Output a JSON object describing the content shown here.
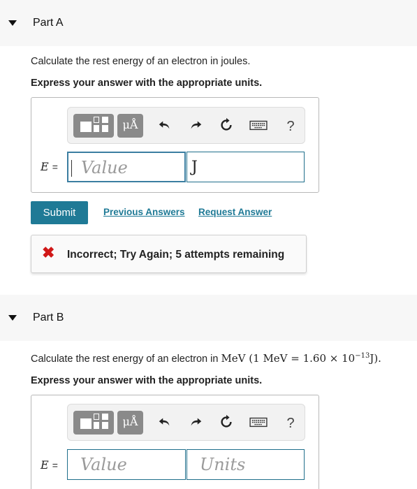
{
  "part_a": {
    "title": "Part A",
    "prompt": "Calculate the rest energy of an electron in joules.",
    "instruction": "Express your answer with the appropriate units.",
    "variable": "E",
    "equals": "=",
    "value_placeholder": "Value",
    "unit_value": "J",
    "submit_label": "Submit",
    "previous_answers_label": "Previous Answers",
    "request_answer_label": "Request Answer",
    "feedback": "Incorrect; Try Again; 5 attempts remaining",
    "feedback_icon": "✖"
  },
  "part_b": {
    "title": "Part B",
    "prompt_text": "Calculate the rest energy of an electron in ",
    "prompt_math": "MeV (1 MeV = 1.60 × 10",
    "prompt_exp": "−13",
    "prompt_tail": "J).",
    "instruction": "Express your answer with the appropriate units.",
    "variable": "E",
    "equals": "=",
    "value_placeholder": "Value",
    "units_placeholder": "Units"
  },
  "toolbar": {
    "units_button": "μÅ",
    "help": "?",
    "icons": [
      "templates-icon",
      "units-icon",
      "undo-icon",
      "redo-icon",
      "reset-icon",
      "keyboard-icon",
      "help-icon"
    ]
  },
  "colors": {
    "accent": "#1f7a96",
    "error": "#d01818"
  }
}
